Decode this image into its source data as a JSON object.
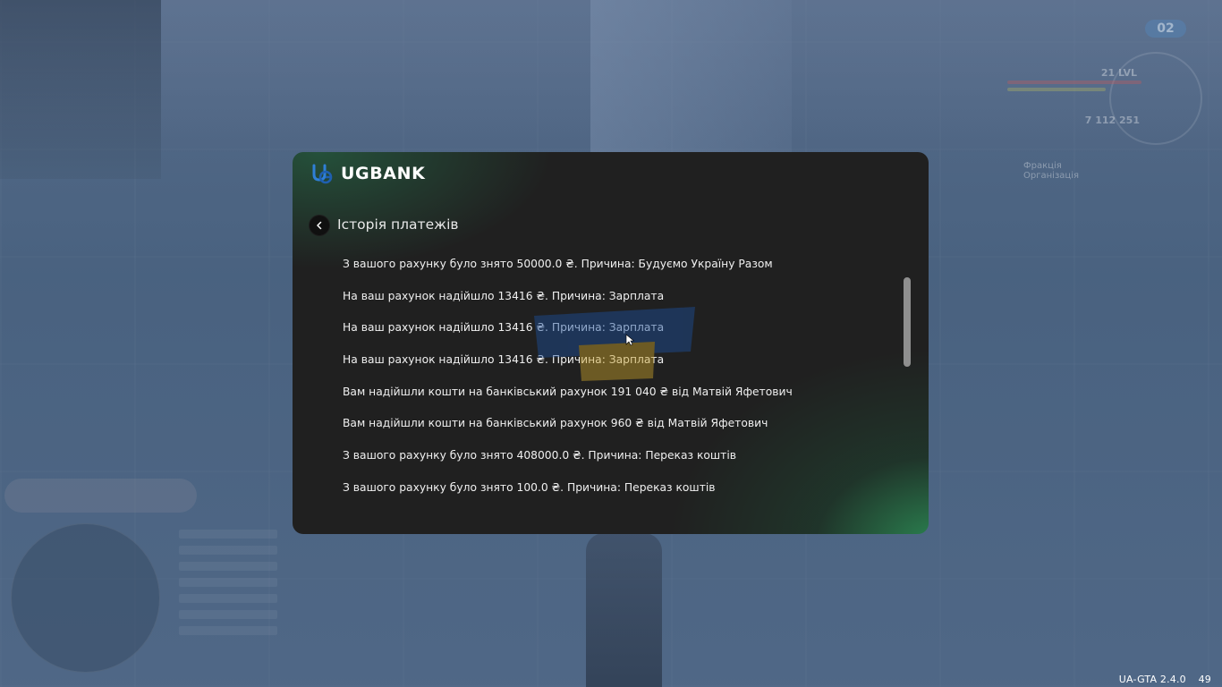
{
  "bank": {
    "brand_name": "UGBANK",
    "section_title": "Історія платежів",
    "accent_color": "#2f9a62",
    "transactions": [
      "З вашого рахунку було знято 50000.0 ₴. Причина: Будуємо Україну Разом",
      "На ваш рахунок надійшло 13416 ₴. Причина: Зарплата",
      "На ваш рахунок надійшло 13416 ₴. Причина: Зарплата",
      "На ваш рахунок надійшло 13416 ₴. Причина: Зарплата",
      "Вам надійшли кошти на банківський рахунок 191 040 ₴ від Матвій Яфетович",
      "Вам надійшли кошти на банківський рахунок 960 ₴ від Матвій Яфетович",
      "З вашого рахунку було знято 408000.0 ₴. Причина: Переказ коштів",
      "З вашого рахунку було знято 100.0 ₴. Причина: Переказ коштів"
    ]
  },
  "hud": {
    "speed": "02",
    "level": "21 LVL",
    "money": "7 112 251",
    "faction_label": "Фракція",
    "org_label": "Організація"
  },
  "footer": {
    "version": "UA-GTA 2.4.0",
    "fps": "49"
  },
  "icons": {
    "back": "chevron-left-icon",
    "logo": "ugbank-logo-icon",
    "watermark": "ukraine-gta-watermark"
  }
}
